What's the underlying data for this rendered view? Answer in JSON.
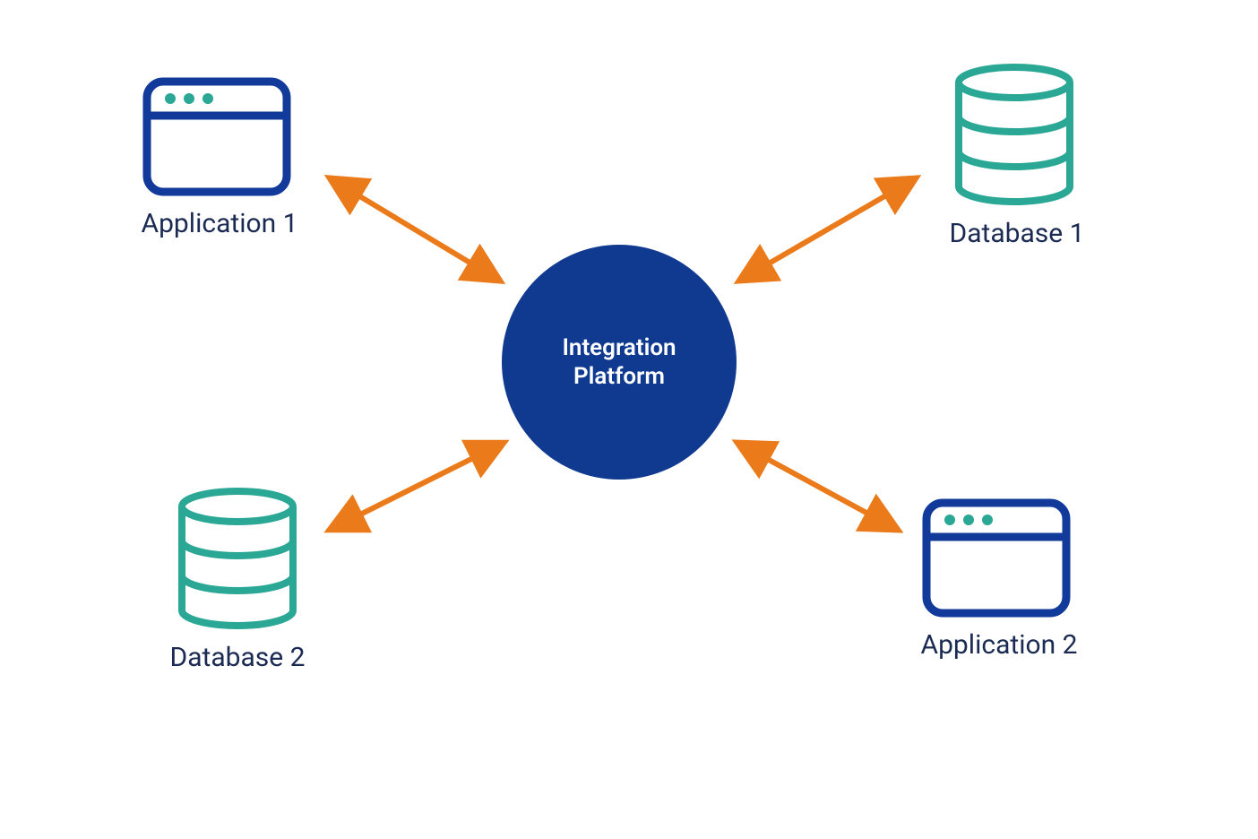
{
  "center": {
    "title_line1": "Integration",
    "title_line2": "Platform"
  },
  "nodes": {
    "top_left": {
      "label": "Application 1",
      "kind": "application"
    },
    "top_right": {
      "label": "Database 1",
      "kind": "database"
    },
    "bottom_left": {
      "label": "Database 2",
      "kind": "database"
    },
    "bottom_right": {
      "label": "Application 2",
      "kind": "application"
    }
  },
  "colors": {
    "app_stroke": "#123a9a",
    "app_dots": "#2aa795",
    "db_stroke": "#2aa795",
    "arrow": "#eb7a1a",
    "center_bg": "#0f3a8f",
    "label_text": "#1a2a52"
  },
  "connections": [
    {
      "from": "top_left",
      "to": "center",
      "bidirectional": true
    },
    {
      "from": "top_right",
      "to": "center",
      "bidirectional": true
    },
    {
      "from": "bottom_left",
      "to": "center",
      "bidirectional": true
    },
    {
      "from": "bottom_right",
      "to": "center",
      "bidirectional": true
    }
  ]
}
